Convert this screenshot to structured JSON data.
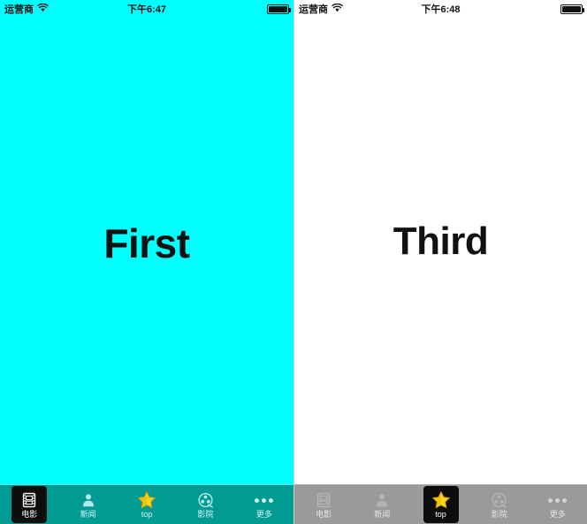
{
  "screens": [
    {
      "id": "left-screen",
      "theme": "cyan",
      "background_color": "#00ffff",
      "status_bar": {
        "carrier": "运营商",
        "wifi_icon": "wifi-icon",
        "time": "下午6:47",
        "battery_icon": "battery-full-icon"
      },
      "content": {
        "label": "First"
      },
      "tab_bar": {
        "background_color": "#029b94",
        "selected_index": 0,
        "items": [
          {
            "label": "电影",
            "icon": "film-strip-icon"
          },
          {
            "label": "新闻",
            "icon": "person-icon"
          },
          {
            "label": "top",
            "icon": "star-icon"
          },
          {
            "label": "影院",
            "icon": "film-reel-icon"
          },
          {
            "label": "更多",
            "icon": "more-dots-icon"
          }
        ]
      }
    },
    {
      "id": "right-screen",
      "theme": "white",
      "background_color": "#ffffff",
      "status_bar": {
        "carrier": "运营商",
        "wifi_icon": "wifi-icon",
        "time": "下午6:48",
        "battery_icon": "battery-full-icon"
      },
      "content": {
        "label": "Third"
      },
      "tab_bar": {
        "background_color": "#9a9a9a",
        "selected_index": 2,
        "items": [
          {
            "label": "电影",
            "icon": "film-strip-icon"
          },
          {
            "label": "新闻",
            "icon": "person-icon"
          },
          {
            "label": "top",
            "icon": "star-icon"
          },
          {
            "label": "影院",
            "icon": "film-reel-icon"
          },
          {
            "label": "更多",
            "icon": "more-dots-icon"
          }
        ]
      }
    }
  ],
  "colors": {
    "cyan": "#00ffff",
    "teal_tabbar": "#029b94",
    "gray_tabbar": "#9a9a9a",
    "selected_tab": "#0d0d0d",
    "star_gold": "#f2c300"
  }
}
